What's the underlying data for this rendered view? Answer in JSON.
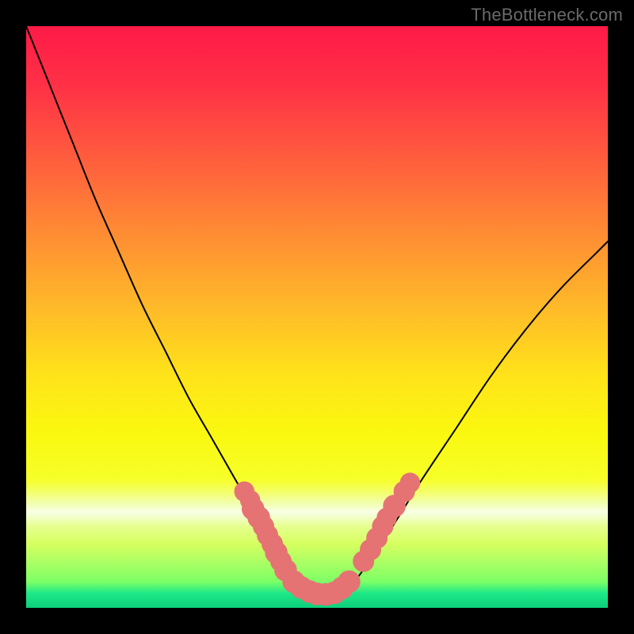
{
  "watermark": "TheBottleneck.com",
  "plot": {
    "inner_left": 33,
    "inner_top": 33,
    "inner_width": 734,
    "inner_height": 734,
    "gradient_stops": [
      {
        "offset": 0.0,
        "color": "#ff1a47"
      },
      {
        "offset": 0.1,
        "color": "#ff3046"
      },
      {
        "offset": 0.22,
        "color": "#ff5a3e"
      },
      {
        "offset": 0.35,
        "color": "#ff8a34"
      },
      {
        "offset": 0.48,
        "color": "#ffb829"
      },
      {
        "offset": 0.6,
        "color": "#ffe31a"
      },
      {
        "offset": 0.7,
        "color": "#faf80f"
      },
      {
        "offset": 0.78,
        "color": "#f6ff2a"
      },
      {
        "offset": 0.8,
        "color": "#f4ff68"
      },
      {
        "offset": 0.82,
        "color": "#f2ffae"
      },
      {
        "offset": 0.835,
        "color": "#f8ffe6"
      },
      {
        "offset": 0.845,
        "color": "#f2ffc5"
      },
      {
        "offset": 0.86,
        "color": "#e6ff8e"
      },
      {
        "offset": 0.89,
        "color": "#d6ff60"
      },
      {
        "offset": 0.955,
        "color": "#7dff66"
      },
      {
        "offset": 0.975,
        "color": "#1de888"
      },
      {
        "offset": 1.0,
        "color": "#0ccf7a"
      }
    ]
  },
  "chart_data": {
    "type": "line",
    "title": "",
    "xlabel": "",
    "ylabel": "",
    "grid": false,
    "x_range": [
      0,
      100
    ],
    "y_range": [
      0,
      100
    ],
    "series": [
      {
        "name": "curve",
        "x": [
          0,
          4,
          8,
          12,
          16,
          20,
          24,
          28,
          32,
          36,
          40,
          43,
          46,
          48,
          50,
          52,
          54,
          56,
          59,
          63,
          68,
          74,
          80,
          86,
          92,
          98,
          100
        ],
        "y": [
          100,
          90,
          80,
          70,
          61,
          52,
          44,
          36,
          29,
          22,
          15,
          10,
          6,
          4,
          2.5,
          2,
          2.5,
          4,
          8,
          14,
          22,
          31,
          40,
          48,
          55,
          61,
          63
        ]
      }
    ],
    "dot_clusters": [
      {
        "name": "left-cluster",
        "color": "#e57373",
        "points": [
          {
            "x": 37.5,
            "y": 20.0,
            "r": 1.2
          },
          {
            "x": 38.5,
            "y": 18.5,
            "r": 1.2
          },
          {
            "x": 39.0,
            "y": 17.0,
            "r": 1.4
          },
          {
            "x": 40.0,
            "y": 15.5,
            "r": 1.4
          },
          {
            "x": 40.8,
            "y": 14.0,
            "r": 1.3
          },
          {
            "x": 41.5,
            "y": 12.5,
            "r": 1.3
          },
          {
            "x": 42.3,
            "y": 11.0,
            "r": 1.3
          },
          {
            "x": 43.0,
            "y": 9.5,
            "r": 1.4
          },
          {
            "x": 43.8,
            "y": 8.0,
            "r": 1.3
          },
          {
            "x": 44.6,
            "y": 6.5,
            "r": 1.4
          }
        ]
      },
      {
        "name": "valley-cluster",
        "color": "#e57373",
        "points": [
          {
            "x": 46.0,
            "y": 4.5,
            "r": 1.4
          },
          {
            "x": 47.3,
            "y": 3.5,
            "r": 1.4
          },
          {
            "x": 48.7,
            "y": 2.8,
            "r": 1.4
          },
          {
            "x": 50.0,
            "y": 2.4,
            "r": 1.4
          },
          {
            "x": 51.5,
            "y": 2.3,
            "r": 1.4
          },
          {
            "x": 53.0,
            "y": 2.6,
            "r": 1.4
          },
          {
            "x": 54.3,
            "y": 3.4,
            "r": 1.4
          },
          {
            "x": 55.5,
            "y": 4.5,
            "r": 1.4
          }
        ]
      },
      {
        "name": "right-cluster",
        "color": "#e57373",
        "points": [
          {
            "x": 58.0,
            "y": 8.0,
            "r": 1.3
          },
          {
            "x": 59.2,
            "y": 10.0,
            "r": 1.3
          },
          {
            "x": 60.3,
            "y": 12.0,
            "r": 1.3
          },
          {
            "x": 61.3,
            "y": 14.0,
            "r": 1.3
          },
          {
            "x": 62.0,
            "y": 15.5,
            "r": 1.2
          },
          {
            "x": 63.3,
            "y": 17.5,
            "r": 1.4
          },
          {
            "x": 65.0,
            "y": 20.0,
            "r": 1.3
          },
          {
            "x": 66.0,
            "y": 21.5,
            "r": 1.2
          }
        ]
      }
    ]
  }
}
